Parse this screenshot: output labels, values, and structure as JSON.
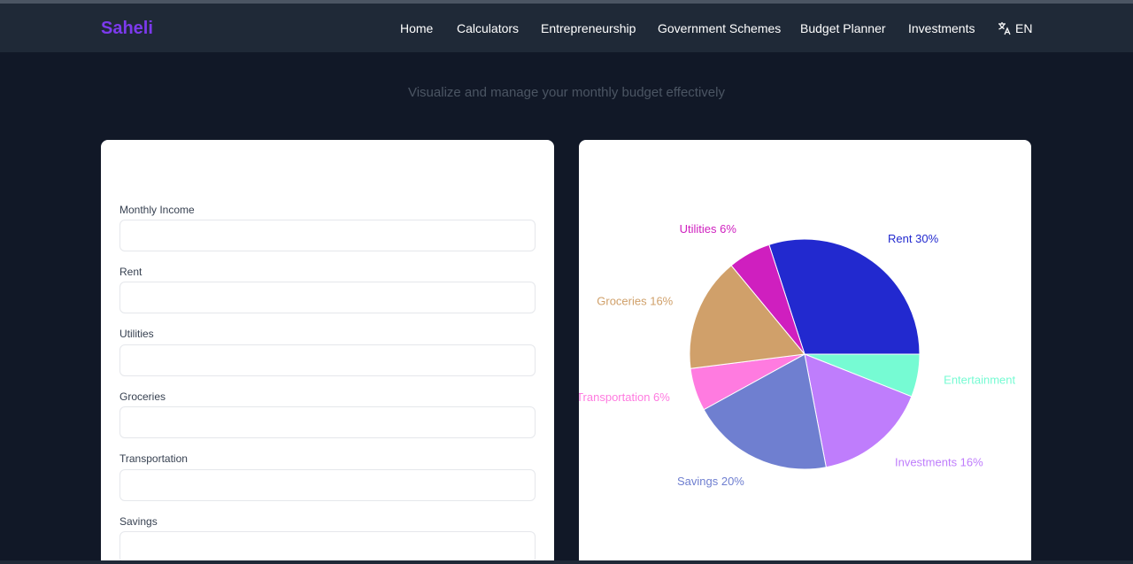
{
  "brand": "Saheli",
  "nav": {
    "items": [
      "Home",
      "Calculators",
      "Entrepreneurship",
      "Government Schemes",
      "Budget Planner",
      "Investments"
    ],
    "language": "EN"
  },
  "subtitle": "Visualize and manage your monthly budget effectively",
  "form": {
    "fields": [
      {
        "label": "Monthly Income",
        "value": ""
      },
      {
        "label": "Rent",
        "value": ""
      },
      {
        "label": "Utilities",
        "value": ""
      },
      {
        "label": "Groceries",
        "value": ""
      },
      {
        "label": "Transportation",
        "value": ""
      },
      {
        "label": "Savings",
        "value": ""
      }
    ]
  },
  "chart_data": {
    "type": "pie",
    "slices": [
      {
        "name": "Rent",
        "label": "Rent 30%",
        "value": 30,
        "color": "#2229cf"
      },
      {
        "name": "Entertainment",
        "label": "Entertainment",
        "value": 6,
        "color": "#76fbd3"
      },
      {
        "name": "Investments",
        "label": "Investments 16%",
        "value": 16,
        "color": "#bf7dfc"
      },
      {
        "name": "Savings",
        "label": "Savings 20%",
        "value": 20,
        "color": "#6f7fd0"
      },
      {
        "name": "Transportation",
        "label": "Transportation 6%",
        "value": 6,
        "color": "#ff7be0"
      },
      {
        "name": "Groceries",
        "label": "Groceries 16%",
        "value": 16,
        "color": "#d0a06a"
      },
      {
        "name": "Utilities",
        "label": "Utilities 6%",
        "value": 6,
        "color": "#cf1fbf"
      }
    ]
  }
}
